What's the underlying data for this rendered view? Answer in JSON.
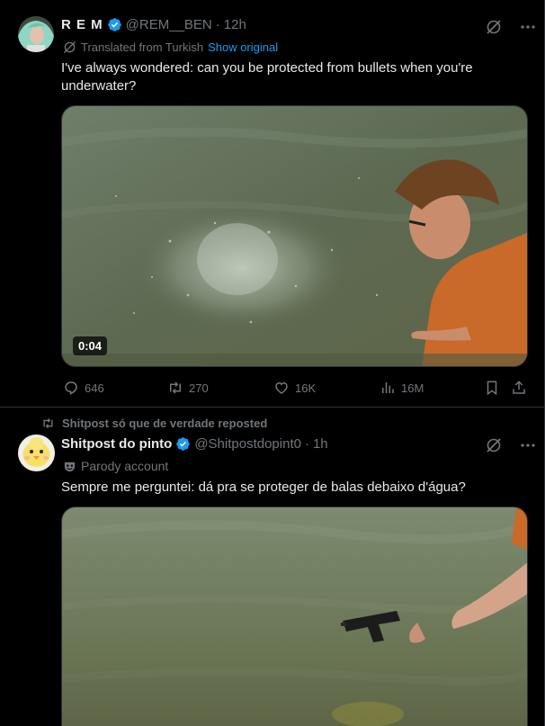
{
  "tweet1": {
    "display_name": "R E M",
    "handle": "@REM__BEN",
    "separator": "·",
    "time": "12h",
    "translated_label": "Translated from Turkish",
    "show_original": "Show original",
    "text": "I've always wondered: can you be protected from bullets when you're underwater?",
    "video_duration": "0:04",
    "replies": "646",
    "reposts": "270",
    "likes": "16K",
    "views": "16M"
  },
  "tweet2": {
    "repost_label": "Shitpost só que de verdade reposted",
    "display_name": "Shitpost do pinto",
    "handle": "@Shitpostdopint0",
    "separator": "·",
    "time": "1h",
    "parody_label": "Parody account",
    "text": "Sempre me perguntei: dá pra se proteger de balas debaixo d'água?"
  },
  "colors": {
    "background": "#000000",
    "text": "#e7e9ea",
    "muted": "#71767b",
    "accent": "#1d9bf0",
    "border": "#2f3336"
  },
  "icons": [
    "verified-badge-icon",
    "grok-icon",
    "more-icon",
    "translate-icon",
    "reply-icon",
    "repost-icon",
    "like-icon",
    "views-icon",
    "bookmark-icon",
    "share-icon",
    "parody-mask-icon"
  ]
}
